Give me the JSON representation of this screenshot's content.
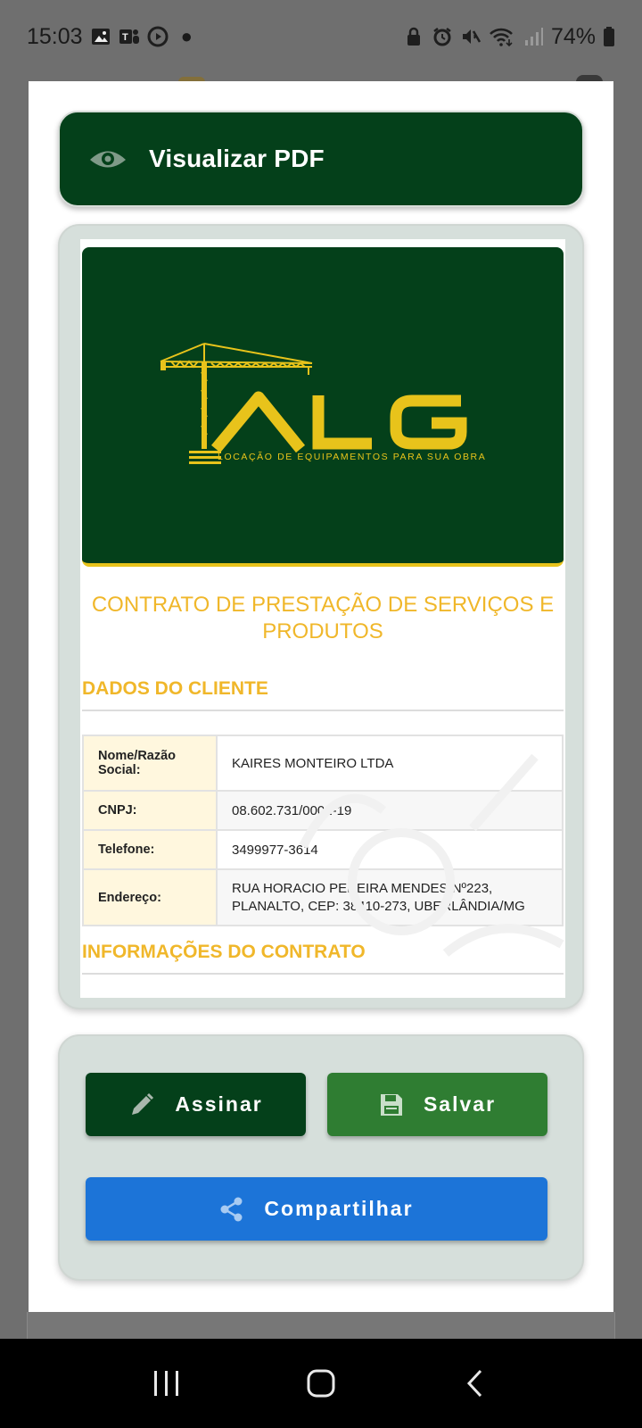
{
  "status_bar": {
    "time": "15:03",
    "battery": "74%",
    "left_icons": [
      "gallery-icon",
      "teams-icon",
      "media-icon",
      "dot-icon"
    ],
    "right_icons": [
      "lock-icon",
      "alarm-icon",
      "mute-icon",
      "wifi-icon",
      "signal-icon",
      "battery-icon"
    ]
  },
  "header": {
    "title": "Visualizar PDF",
    "icon": "eye-icon"
  },
  "document": {
    "logo": {
      "brand": "ALG",
      "tagline": "LOCAÇÃO DE EQUIPAMENTOS PARA SUA OBRA"
    },
    "title": "CONTRATO DE PRESTAÇÃO DE SERVIÇOS E PRODUTOS",
    "client_section_title": "DADOS DO CLIENTE",
    "client_table": {
      "rows": [
        {
          "label": "Nome/Razão Social:",
          "value": "KAIRES MONTEIRO LTDA"
        },
        {
          "label": "CNPJ:",
          "value": "08.602.731/0001-19"
        },
        {
          "label": "Telefone:",
          "value": "3499977-3614"
        },
        {
          "label": "Endereço:",
          "value": "RUA HORACIO PEREIRA MENDES Nº223, PLANALTO, CEP: 38410-273, UBERLÂNDIA/MG"
        }
      ]
    },
    "contract_section_title": "INFORMAÇÕES DO CONTRATO"
  },
  "actions": {
    "sign_label": "Assinar",
    "save_label": "Salvar",
    "share_label": "Compartilhar"
  },
  "colors": {
    "brand_green": "#04401a",
    "accent_yellow": "#f0b72a",
    "save_green": "#2f7d32",
    "share_blue": "#1c74d8"
  },
  "nav_bar": {
    "buttons": [
      "recent-apps-icon",
      "home-icon",
      "back-icon"
    ]
  }
}
